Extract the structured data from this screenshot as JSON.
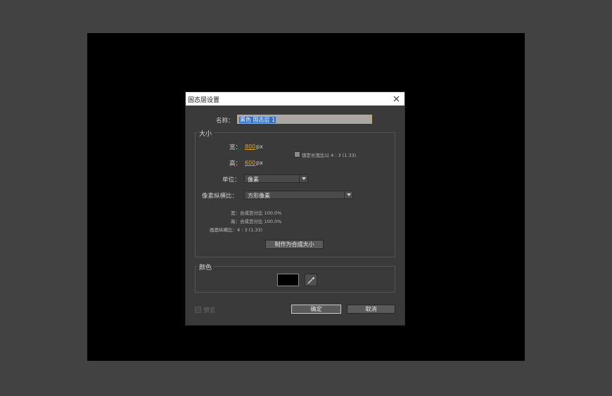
{
  "dialog": {
    "title": "固态层设置",
    "name_label": "名称：",
    "name_value": "黑色 固态层 1"
  },
  "size": {
    "legend": "大小",
    "width_label": "宽：",
    "width_value": "800",
    "width_unit": "px",
    "height_label": "高：",
    "height_value": "600",
    "height_unit": "px",
    "lock_aspect": "锁定长宽比以 4 : 3 (1.33)",
    "lock_checked": false,
    "units_label": "单位：",
    "units_value": "像素",
    "par_label": "像素纵横比：",
    "par_value": "方形像素",
    "info_width": "宽：合成百分比 100.0%",
    "info_height": "高：合成百分比 100.0%",
    "info_frame": "画面纵横比：4 : 3 (1.33)",
    "make_comp_size": "制作为合成大小"
  },
  "color": {
    "legend": "颜色",
    "swatch": "#000000"
  },
  "footer": {
    "preview_label": "预览",
    "ok_label": "确定",
    "cancel_label": "取消"
  },
  "colors": {
    "background": "#424242",
    "dialog": "#3a3a3a",
    "accent": "#e0a12c",
    "selection": "#2e6fd0"
  }
}
